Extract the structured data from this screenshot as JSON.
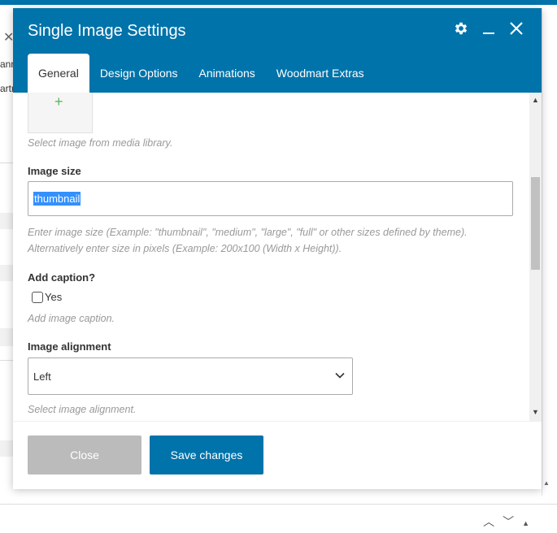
{
  "background": {
    "fragments": [
      "ann",
      "artm"
    ]
  },
  "modal": {
    "title": "Single Image Settings",
    "tabs": [
      {
        "label": "General",
        "active": true
      },
      {
        "label": "Design Options",
        "active": false
      },
      {
        "label": "Animations",
        "active": false
      },
      {
        "label": "Woodmart Extras",
        "active": false
      }
    ],
    "image_field": {
      "hint": "Select image from media library."
    },
    "image_size": {
      "label": "Image size",
      "value": "thumbnail",
      "hint_line1": "Enter image size (Example: \"thumbnail\", \"medium\", \"large\", \"full\" or other sizes defined by theme).",
      "hint_line2": "Alternatively enter size in pixels (Example: 200x100 (Width x Height))."
    },
    "caption": {
      "label": "Add caption?",
      "checkbox_label": "Yes",
      "checked": false,
      "hint": "Add image caption."
    },
    "alignment": {
      "label": "Image alignment",
      "value": "Left",
      "hint": "Select image alignment."
    },
    "footer": {
      "close_label": "Close",
      "save_label": "Save changes"
    }
  },
  "colors": {
    "header": "#0073aa",
    "save_button": "#0073aa",
    "close_button": "#bbbbbb",
    "selection": "#3390ff",
    "plus": "#5cb85c"
  }
}
